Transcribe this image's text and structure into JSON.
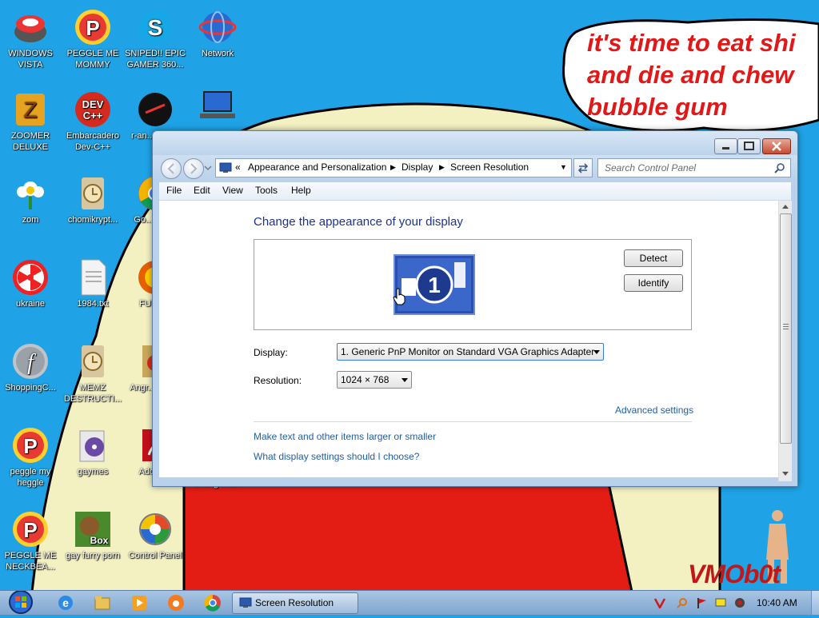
{
  "wallpaper": {
    "bubble_lines": [
      "it's time to eat shi",
      "and die and chew",
      "bubble gum"
    ],
    "watermark": "VMOb0t"
  },
  "desktop_icons": [
    {
      "label": "WINDOWS VISTA",
      "icon": "vista-pod-icon"
    },
    {
      "label": "PEGGLE ME MOMMY",
      "icon": "peggle-icon"
    },
    {
      "label": "SNIPED!! EPIC GAMER 360...",
      "icon": "skype-icon"
    },
    {
      "label": "Network",
      "icon": "network-icon"
    },
    {
      "label": "ZOOMER DELUXE",
      "icon": "zuma-icon"
    },
    {
      "label": "Embarcadero Dev-C++",
      "icon": "devcpp-icon"
    },
    {
      "label": "r-an... part...",
      "icon": "red-circle-icon"
    },
    {
      "label": "",
      "icon": "laptop-icon"
    },
    {
      "label": "zom",
      "icon": "flower-icon"
    },
    {
      "label": "chomikrypt...",
      "icon": "clock-app-icon"
    },
    {
      "label": "Go... Chr...",
      "icon": "chrome-icon"
    },
    {
      "label": "ukraine",
      "icon": "radiation-icon"
    },
    {
      "label": "1984.txt",
      "icon": "text-file-icon"
    },
    {
      "label": "FURR...",
      "icon": "firefox-icon"
    },
    {
      "label": "ShoppingC...",
      "icon": "flash-icon"
    },
    {
      "label": "MEMZ DESTRUCTI...",
      "icon": "clock-app-icon"
    },
    {
      "label": "Angr... Sea...",
      "icon": "angry-birds-icon"
    },
    {
      "label": "peggle my heggle",
      "icon": "peggle-icon"
    },
    {
      "label": "gaymes",
      "icon": "folder-media-icon"
    },
    {
      "label": "Adobe...",
      "icon": "adobe-icon"
    },
    {
      "label": "wrong mu...",
      "icon": "blank-icon"
    },
    {
      "label": "PEGGLE ME NECKBEA...",
      "icon": "peggle-icon"
    },
    {
      "label": "gay furry porn",
      "icon": "box-beaver-icon"
    },
    {
      "label": "Control Panel",
      "icon": "control-panel-icon"
    }
  ],
  "window": {
    "breadcrumb": [
      "Appearance and Personalization",
      "Display",
      "Screen Resolution"
    ],
    "breadcrumb_prefix": "«",
    "search_placeholder": "Search Control Panel",
    "menu": [
      "File",
      "Edit",
      "View",
      "Tools",
      "Help"
    ],
    "heading": "Change the appearance of your display",
    "monitor_number": "1",
    "detect_label": "Detect",
    "identify_label": "Identify",
    "display_label": "Display:",
    "display_value": "1. Generic PnP Monitor on Standard VGA Graphics Adapter",
    "resolution_label": "Resolution:",
    "resolution_value": "1024 × 768",
    "advanced_link": "Advanced settings",
    "link_text_size": "Make text and other items larger or smaller",
    "link_help": "What display settings should I choose?"
  },
  "taskbar": {
    "task_label": "Screen Resolution",
    "clock": "10:40 AM"
  },
  "colors": {
    "desktop_bg": "#1fa3e6",
    "link": "#1f5fa9",
    "heading": "#1e3287",
    "bubble_text": "#e01818"
  }
}
